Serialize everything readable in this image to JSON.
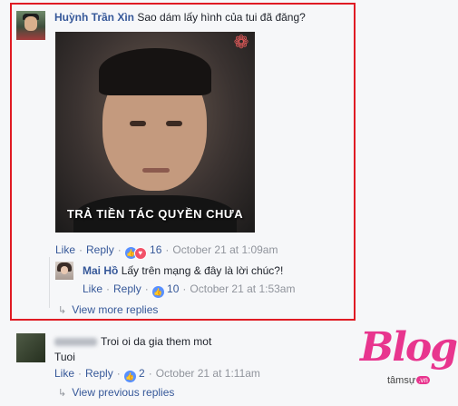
{
  "comment": {
    "author": "Huỳnh Trần Xìn",
    "text": "Sao dám lấy hình của tui đã đăng?",
    "image_caption": "TRẢ TIỀN TÁC QUYỀN CHƯA",
    "actions": {
      "like": "Like",
      "reply": "Reply",
      "reaction_count": "16",
      "timestamp": "October 21 at 1:09am"
    }
  },
  "reply": {
    "author": "Mai Hồ",
    "text": "Lấy trên mạng & đây là lời chúc?!",
    "actions": {
      "like": "Like",
      "reply": "Reply",
      "reaction_count": "10",
      "timestamp": "October 21 at 1:53am"
    }
  },
  "view_more_replies": "View more replies",
  "comment2": {
    "text_line1": "Troi oi da gia them mot",
    "text_line2": "Tuoi",
    "actions": {
      "like": "Like",
      "reply": "Reply",
      "reaction_count": "2",
      "timestamp": "October 21 at 1:11am"
    }
  },
  "view_previous_replies": "View previous replies",
  "watermark": {
    "brand": "Blog",
    "sub": "tâmsự",
    "tld": ".vn"
  },
  "colors": {
    "link": "#365899",
    "meta": "#90949c",
    "highlight_border": "#e01b24",
    "like_blue": "#5890ff",
    "love_red": "#f25268",
    "brand_pink": "#e8358e"
  }
}
